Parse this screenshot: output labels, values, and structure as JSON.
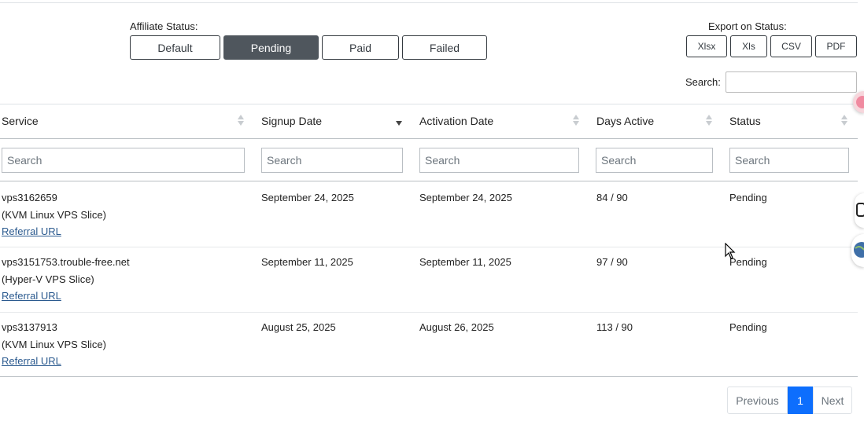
{
  "affiliate_status": {
    "label": "Affiliate Status:",
    "buttons": [
      "Default",
      "Pending",
      "Paid",
      "Failed"
    ],
    "active": "Pending"
  },
  "export": {
    "label": "Export on Status:",
    "buttons": [
      "Xlsx",
      "Xls",
      "CSV",
      "PDF"
    ]
  },
  "search": {
    "label": "Search:",
    "value": ""
  },
  "table": {
    "columns": [
      "Service",
      "Signup Date",
      "Activation Date",
      "Days Active",
      "Status"
    ],
    "sorted_column": "Signup Date",
    "sort_direction": "desc",
    "column_search_placeholder": "Search",
    "rows": [
      {
        "service": "vps3162659",
        "type": "(KVM Linux VPS Slice)",
        "link": "Referral URL",
        "signup": "September 24, 2025",
        "activation": "September 24, 2025",
        "days": "84 / 90",
        "status": "Pending"
      },
      {
        "service": "vps3151753.trouble-free.net",
        "type": "(Hyper-V VPS Slice)",
        "link": "Referral URL",
        "signup": "September 11, 2025",
        "activation": "September 11, 2025",
        "days": "97 / 90",
        "status": "Pending"
      },
      {
        "service": "vps3137913",
        "type": "(KVM Linux VPS Slice)",
        "link": "Referral URL",
        "signup": "August 25, 2025",
        "activation": "August 26, 2025",
        "days": "113 / 90",
        "status": "Pending"
      }
    ]
  },
  "pagination": {
    "previous": "Previous",
    "current": "1",
    "next": "Next"
  },
  "colors": {
    "active_button": "#4f565d",
    "page_active": "#0d6efd",
    "link": "#2b5a8f"
  }
}
